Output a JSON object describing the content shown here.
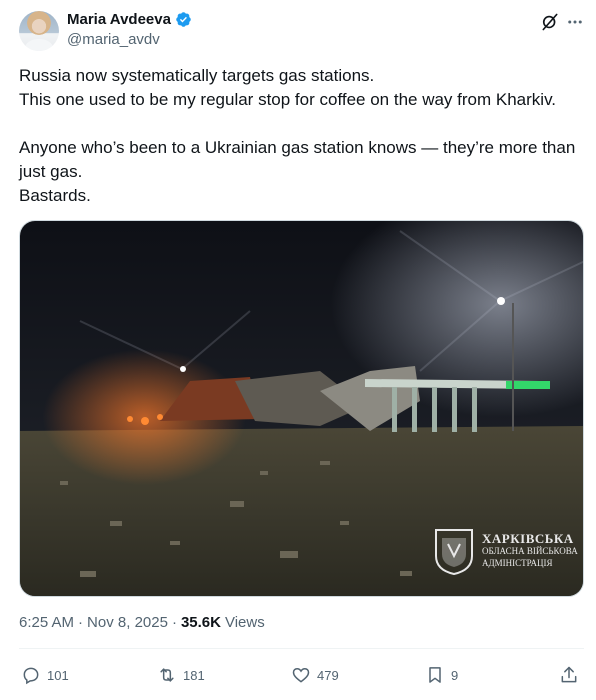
{
  "author": {
    "display_name": "Maria Avdeeva",
    "handle": "@maria_avdv",
    "verified": true
  },
  "tweet": {
    "paragraphs": [
      [
        "Russia now systematically targets gas stations.",
        "This one used to be my regular stop for coffee on the way from Kharkiv."
      ],
      [
        "Anyone who’s been to a Ukrainian gas station knows — they’re more than just gas.",
        "Bastards."
      ]
    ]
  },
  "media": {
    "watermark": {
      "line1": "ХАРКІВСЬКА",
      "line2": "ОБЛАСНА ВІЙСЬКОВА",
      "line3": "АДМІНІСТРАЦІЯ"
    }
  },
  "meta": {
    "time": "6:25 AM",
    "separator": "·",
    "date": "Nov 8, 2025",
    "separator2": "·",
    "views_count": "35.6K",
    "views_label": "Views"
  },
  "actions": {
    "replies": "101",
    "reposts": "181",
    "likes": "479",
    "bookmarks": "9"
  },
  "icons": {
    "verified": "verified-badge-icon",
    "grok": "grok-icon",
    "more": "more-icon",
    "reply": "reply-icon",
    "repost": "repost-icon",
    "like": "heart-icon",
    "bookmark": "bookmark-icon",
    "share": "share-icon"
  },
  "colors": {
    "text": "#0f1419",
    "secondary": "#536471",
    "verified": "#1d9bf0",
    "divider": "#eff3f4"
  }
}
